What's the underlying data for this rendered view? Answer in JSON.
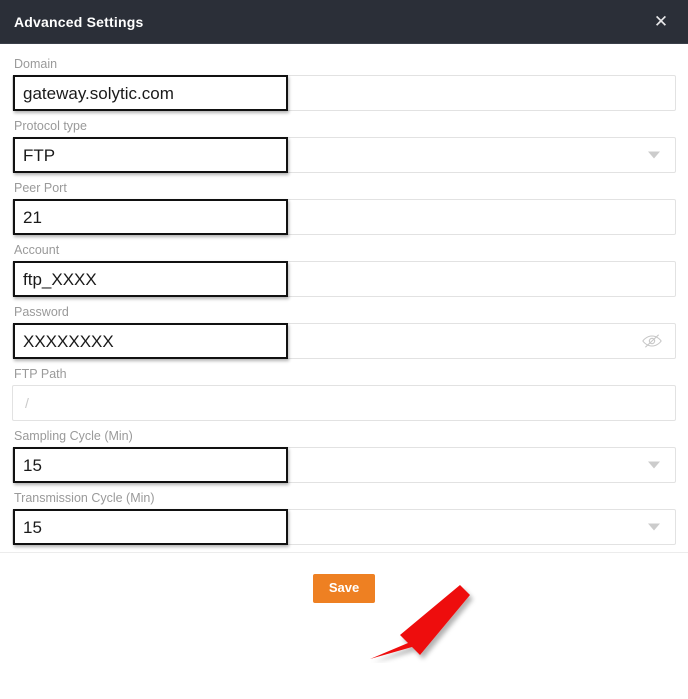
{
  "window": {
    "title": "Advanced Settings",
    "close_icon": "close-icon",
    "header_bg": "#2b2f38"
  },
  "form": {
    "fields": [
      {
        "label": "Domain",
        "value": "gateway.solytic.com",
        "type": "text",
        "annotated": true,
        "icon": "none"
      },
      {
        "label": "Protocol type",
        "value": "FTP",
        "type": "select",
        "annotated": true,
        "icon": "chevron-down-icon"
      },
      {
        "label": "Peer Port",
        "value": "21",
        "type": "text",
        "annotated": true,
        "icon": "none"
      },
      {
        "label": "Account",
        "value": "ftp_XXXX",
        "type": "text",
        "annotated": true,
        "icon": "none"
      },
      {
        "label": "Password",
        "value": "XXXXXXXX",
        "type": "password",
        "annotated": true,
        "icon": "eye-off-icon"
      },
      {
        "label": "FTP Path",
        "value": "/",
        "type": "text",
        "annotated": false,
        "icon": "none",
        "is_placeholder": true
      },
      {
        "label": "Sampling Cycle (Min)",
        "value": "15",
        "type": "select",
        "annotated": true,
        "icon": "chevron-down-icon"
      },
      {
        "label": "Transmission Cycle (Min)",
        "value": "15",
        "type": "select",
        "annotated": true,
        "icon": "chevron-down-icon"
      }
    ]
  },
  "footer": {
    "save_label": "Save",
    "save_color": "#ee8022"
  },
  "annotations": {
    "arrow_color": "#ee1111",
    "highlight_color": "#111111"
  }
}
